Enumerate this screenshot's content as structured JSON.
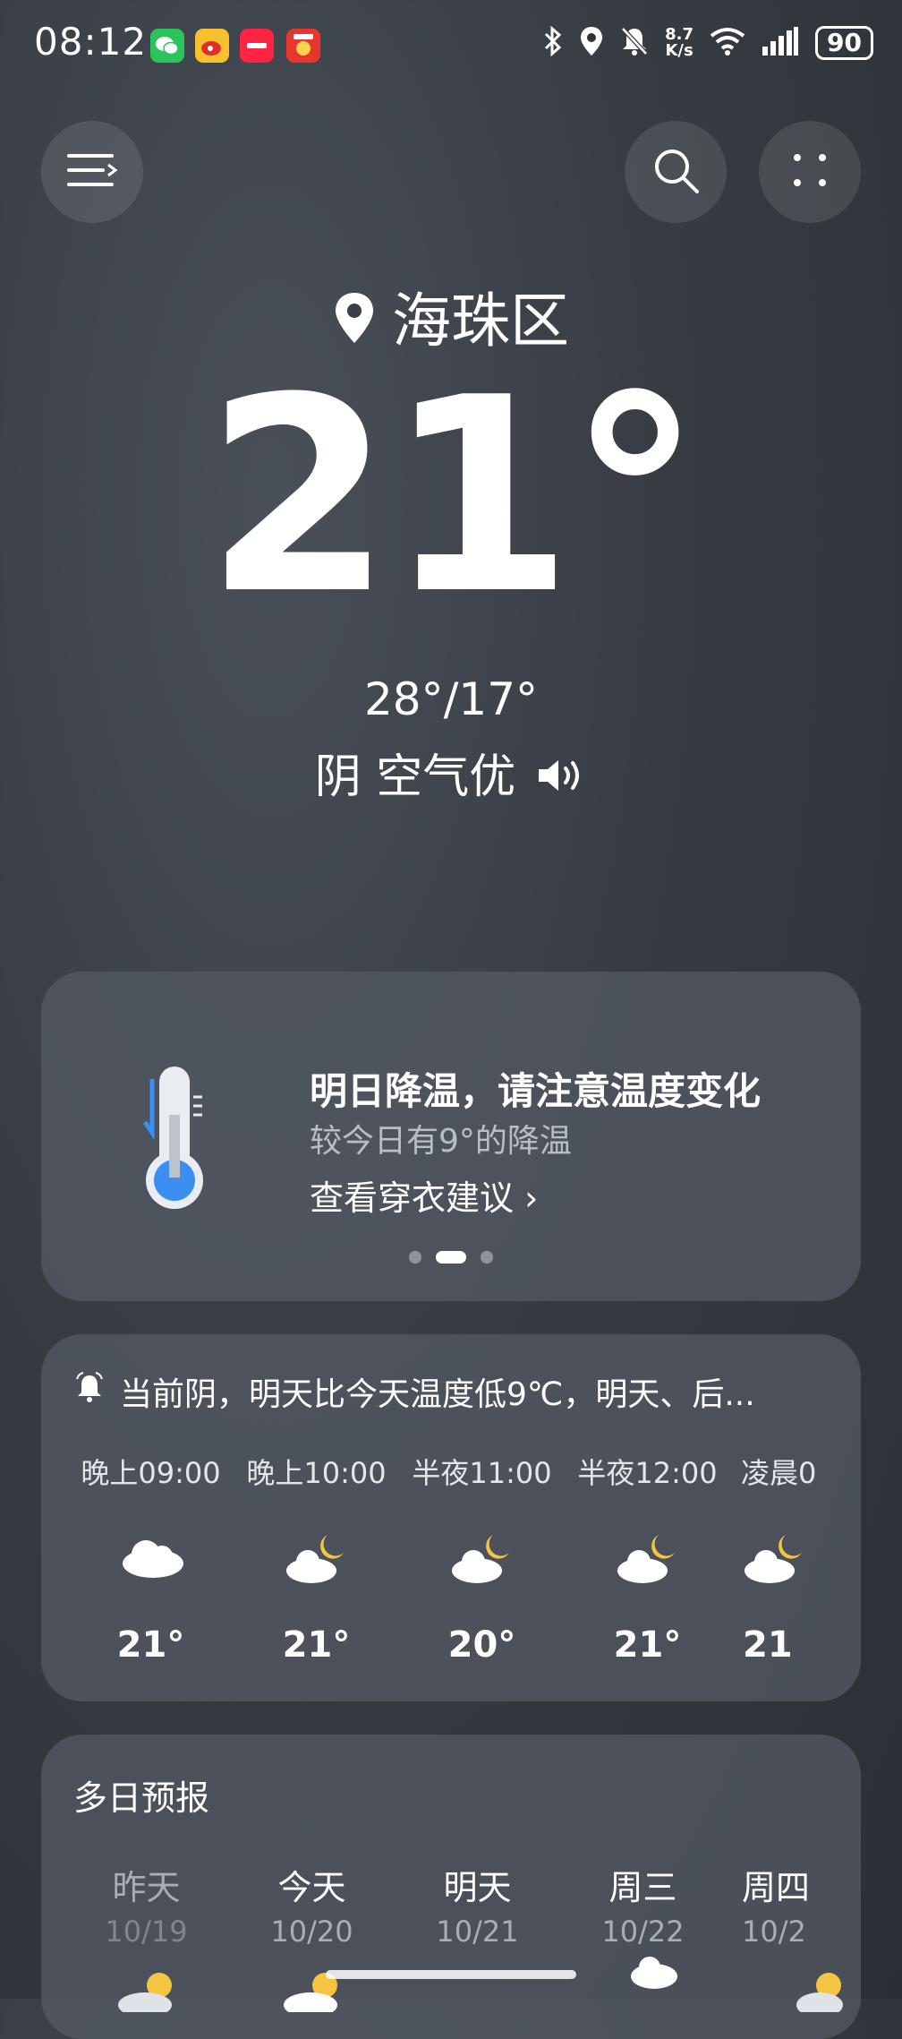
{
  "status_bar": {
    "time": "08:12",
    "net_speed_value": "8.7",
    "net_speed_unit": "K/s",
    "battery": "90"
  },
  "location": {
    "name": "海珠区"
  },
  "current": {
    "temperature": "21°",
    "high_low": "28°/17°",
    "condition": "阴 空气优"
  },
  "alert_card": {
    "title": "明日降温，请注意温度变化",
    "subtitle": "较今日有9°的降温",
    "link": "查看穿衣建议 ›",
    "page_index": 2,
    "page_count": 3
  },
  "hourly": {
    "summary": "当前阴，明天比今天温度低9℃，明天、后...",
    "items": [
      {
        "time": "晚上09:00",
        "icon": "cloudy-icon",
        "temp": "21°"
      },
      {
        "time": "晚上10:00",
        "icon": "partly-cloudy-night-icon",
        "temp": "21°"
      },
      {
        "time": "半夜11:00",
        "icon": "partly-cloudy-night-icon",
        "temp": "20°"
      },
      {
        "time": "半夜12:00",
        "icon": "partly-cloudy-night-icon",
        "temp": "21°"
      },
      {
        "time": "凌晨0",
        "icon": "partly-cloudy-night-icon",
        "temp": "21"
      }
    ]
  },
  "daily": {
    "title": "多日预报",
    "items": [
      {
        "name": "昨天",
        "date": "10/19"
      },
      {
        "name": "今天",
        "date": "10/20"
      },
      {
        "name": "明天",
        "date": "10/21"
      },
      {
        "name": "周三",
        "date": "10/22"
      },
      {
        "name": "周四",
        "date": "10/2"
      }
    ]
  },
  "colors": {
    "background": "#373c43",
    "card": "#545a64",
    "thermometer_blue": "#3a8ff0",
    "moon": "#f5c542"
  }
}
